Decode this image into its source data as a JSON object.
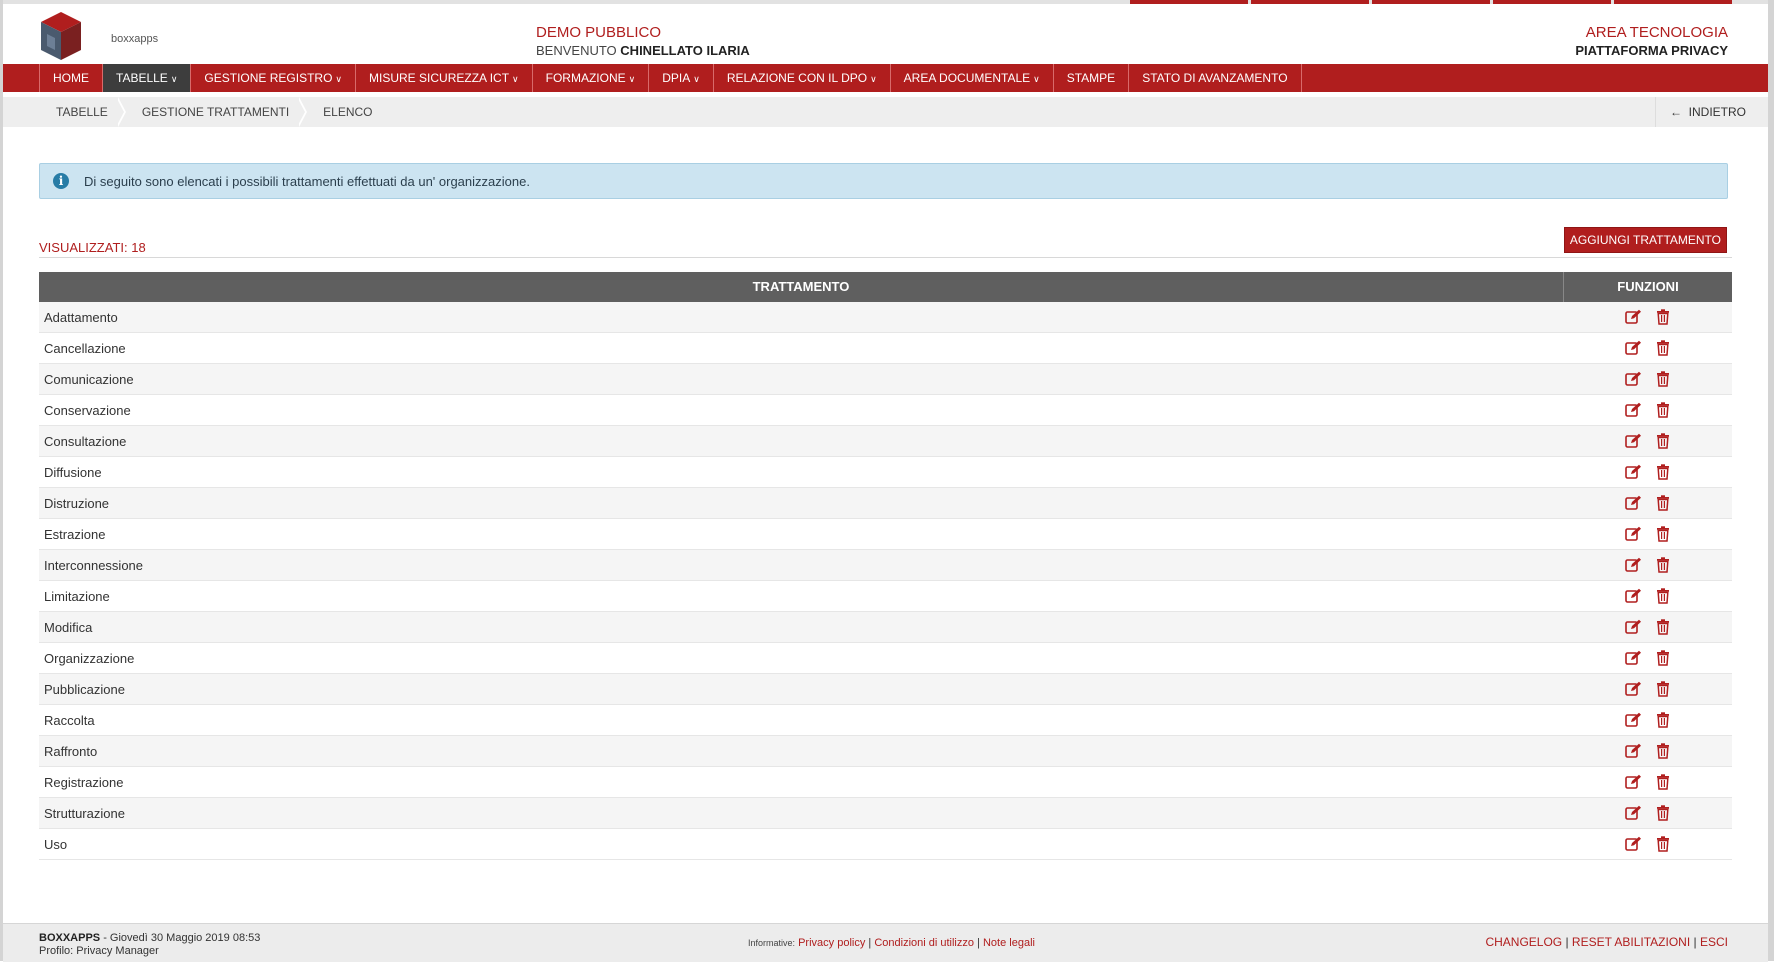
{
  "header": {
    "logo_text": "boxxapps",
    "center_line1": "DEMO PUBBLICO",
    "welcome_prefix": "BENVENUTO",
    "user_name": "CHINELLATO ILARIA",
    "right_line1": "AREA TECNOLOGIA",
    "right_line2": "PIATTAFORMA PRIVACY"
  },
  "nav": [
    {
      "label": "HOME",
      "dropdown": false,
      "active": false
    },
    {
      "label": "TABELLE",
      "dropdown": true,
      "active": true
    },
    {
      "label": "GESTIONE REGISTRO",
      "dropdown": true,
      "active": false
    },
    {
      "label": "MISURE SICUREZZA ICT",
      "dropdown": true,
      "active": false
    },
    {
      "label": "FORMAZIONE",
      "dropdown": true,
      "active": false
    },
    {
      "label": "DPIA",
      "dropdown": true,
      "active": false
    },
    {
      "label": "RELAZIONE CON IL DPO",
      "dropdown": true,
      "active": false
    },
    {
      "label": "AREA DOCUMENTALE",
      "dropdown": true,
      "active": false
    },
    {
      "label": "STAMPE",
      "dropdown": false,
      "active": false
    },
    {
      "label": "STATO DI AVANZAMENTO",
      "dropdown": false,
      "active": false
    }
  ],
  "breadcrumb": [
    "TABELLE",
    "GESTIONE TRATTAMENTI",
    "ELENCO"
  ],
  "back_label": "INDIETRO",
  "info_message": "Di seguito sono elencati i possibili trattamenti effettuati da un' organizzazione.",
  "count_label": "VISUALIZZATI: 18",
  "add_button_label": "AGGIUNGI TRATTAMENTO",
  "table": {
    "col_name": "TRATTAMENTO",
    "col_functions": "FUNZIONI",
    "rows": [
      "Adattamento",
      "Cancellazione",
      "Comunicazione",
      "Conservazione",
      "Consultazione",
      "Diffusione",
      "Distruzione",
      "Estrazione",
      "Interconnessione",
      "Limitazione",
      "Modifica",
      "Organizzazione",
      "Pubblicazione",
      "Raccolta",
      "Raffronto",
      "Registrazione",
      "Strutturazione",
      "Uso"
    ]
  },
  "footer": {
    "brand": "BOXXAPPS",
    "datetime": " - Giovedì 30 Maggio 2019 08:53",
    "profile": "Profilo: Privacy Manager",
    "info_label": "Informative:",
    "links_center": [
      "Privacy policy",
      "Condizioni di utilizzo",
      "Note legali"
    ],
    "links_right": [
      "CHANGELOG",
      "RESET ABILITAZIONI",
      "ESCI"
    ]
  },
  "colors": {
    "brand_red": "#b01e1e",
    "active_nav": "#3d3d3d",
    "table_header": "#5f5f5f",
    "info_bg": "#cce4f1"
  }
}
